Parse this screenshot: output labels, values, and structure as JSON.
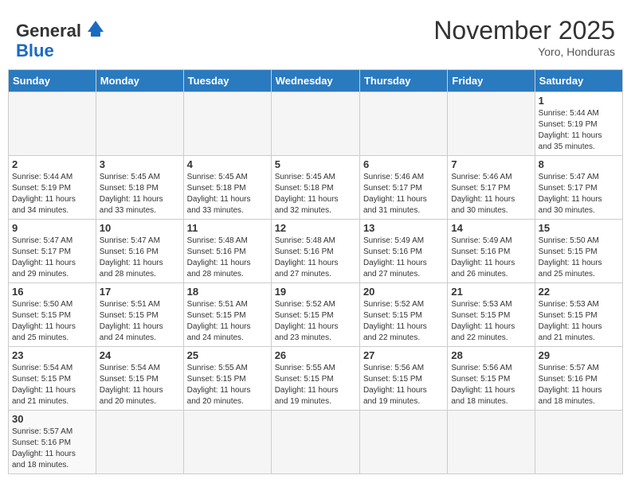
{
  "header": {
    "logo_general": "General",
    "logo_blue": "Blue",
    "month_title": "November 2025",
    "location": "Yoro, Honduras"
  },
  "weekdays": [
    "Sunday",
    "Monday",
    "Tuesday",
    "Wednesday",
    "Thursday",
    "Friday",
    "Saturday"
  ],
  "weeks": [
    [
      {
        "day": "",
        "info": ""
      },
      {
        "day": "",
        "info": ""
      },
      {
        "day": "",
        "info": ""
      },
      {
        "day": "",
        "info": ""
      },
      {
        "day": "",
        "info": ""
      },
      {
        "day": "",
        "info": ""
      },
      {
        "day": "1",
        "info": "Sunrise: 5:44 AM\nSunset: 5:19 PM\nDaylight: 11 hours\nand 35 minutes."
      }
    ],
    [
      {
        "day": "2",
        "info": "Sunrise: 5:44 AM\nSunset: 5:19 PM\nDaylight: 11 hours\nand 34 minutes."
      },
      {
        "day": "3",
        "info": "Sunrise: 5:45 AM\nSunset: 5:18 PM\nDaylight: 11 hours\nand 33 minutes."
      },
      {
        "day": "4",
        "info": "Sunrise: 5:45 AM\nSunset: 5:18 PM\nDaylight: 11 hours\nand 33 minutes."
      },
      {
        "day": "5",
        "info": "Sunrise: 5:45 AM\nSunset: 5:18 PM\nDaylight: 11 hours\nand 32 minutes."
      },
      {
        "day": "6",
        "info": "Sunrise: 5:46 AM\nSunset: 5:17 PM\nDaylight: 11 hours\nand 31 minutes."
      },
      {
        "day": "7",
        "info": "Sunrise: 5:46 AM\nSunset: 5:17 PM\nDaylight: 11 hours\nand 30 minutes."
      },
      {
        "day": "8",
        "info": "Sunrise: 5:47 AM\nSunset: 5:17 PM\nDaylight: 11 hours\nand 30 minutes."
      }
    ],
    [
      {
        "day": "9",
        "info": "Sunrise: 5:47 AM\nSunset: 5:17 PM\nDaylight: 11 hours\nand 29 minutes."
      },
      {
        "day": "10",
        "info": "Sunrise: 5:47 AM\nSunset: 5:16 PM\nDaylight: 11 hours\nand 28 minutes."
      },
      {
        "day": "11",
        "info": "Sunrise: 5:48 AM\nSunset: 5:16 PM\nDaylight: 11 hours\nand 28 minutes."
      },
      {
        "day": "12",
        "info": "Sunrise: 5:48 AM\nSunset: 5:16 PM\nDaylight: 11 hours\nand 27 minutes."
      },
      {
        "day": "13",
        "info": "Sunrise: 5:49 AM\nSunset: 5:16 PM\nDaylight: 11 hours\nand 27 minutes."
      },
      {
        "day": "14",
        "info": "Sunrise: 5:49 AM\nSunset: 5:16 PM\nDaylight: 11 hours\nand 26 minutes."
      },
      {
        "day": "15",
        "info": "Sunrise: 5:50 AM\nSunset: 5:15 PM\nDaylight: 11 hours\nand 25 minutes."
      }
    ],
    [
      {
        "day": "16",
        "info": "Sunrise: 5:50 AM\nSunset: 5:15 PM\nDaylight: 11 hours\nand 25 minutes."
      },
      {
        "day": "17",
        "info": "Sunrise: 5:51 AM\nSunset: 5:15 PM\nDaylight: 11 hours\nand 24 minutes."
      },
      {
        "day": "18",
        "info": "Sunrise: 5:51 AM\nSunset: 5:15 PM\nDaylight: 11 hours\nand 24 minutes."
      },
      {
        "day": "19",
        "info": "Sunrise: 5:52 AM\nSunset: 5:15 PM\nDaylight: 11 hours\nand 23 minutes."
      },
      {
        "day": "20",
        "info": "Sunrise: 5:52 AM\nSunset: 5:15 PM\nDaylight: 11 hours\nand 22 minutes."
      },
      {
        "day": "21",
        "info": "Sunrise: 5:53 AM\nSunset: 5:15 PM\nDaylight: 11 hours\nand 22 minutes."
      },
      {
        "day": "22",
        "info": "Sunrise: 5:53 AM\nSunset: 5:15 PM\nDaylight: 11 hours\nand 21 minutes."
      }
    ],
    [
      {
        "day": "23",
        "info": "Sunrise: 5:54 AM\nSunset: 5:15 PM\nDaylight: 11 hours\nand 21 minutes."
      },
      {
        "day": "24",
        "info": "Sunrise: 5:54 AM\nSunset: 5:15 PM\nDaylight: 11 hours\nand 20 minutes."
      },
      {
        "day": "25",
        "info": "Sunrise: 5:55 AM\nSunset: 5:15 PM\nDaylight: 11 hours\nand 20 minutes."
      },
      {
        "day": "26",
        "info": "Sunrise: 5:55 AM\nSunset: 5:15 PM\nDaylight: 11 hours\nand 19 minutes."
      },
      {
        "day": "27",
        "info": "Sunrise: 5:56 AM\nSunset: 5:15 PM\nDaylight: 11 hours\nand 19 minutes."
      },
      {
        "day": "28",
        "info": "Sunrise: 5:56 AM\nSunset: 5:15 PM\nDaylight: 11 hours\nand 18 minutes."
      },
      {
        "day": "29",
        "info": "Sunrise: 5:57 AM\nSunset: 5:16 PM\nDaylight: 11 hours\nand 18 minutes."
      }
    ],
    [
      {
        "day": "30",
        "info": "Sunrise: 5:57 AM\nSunset: 5:16 PM\nDaylight: 11 hours\nand 18 minutes."
      },
      {
        "day": "",
        "info": ""
      },
      {
        "day": "",
        "info": ""
      },
      {
        "day": "",
        "info": ""
      },
      {
        "day": "",
        "info": ""
      },
      {
        "day": "",
        "info": ""
      },
      {
        "day": "",
        "info": ""
      }
    ]
  ]
}
